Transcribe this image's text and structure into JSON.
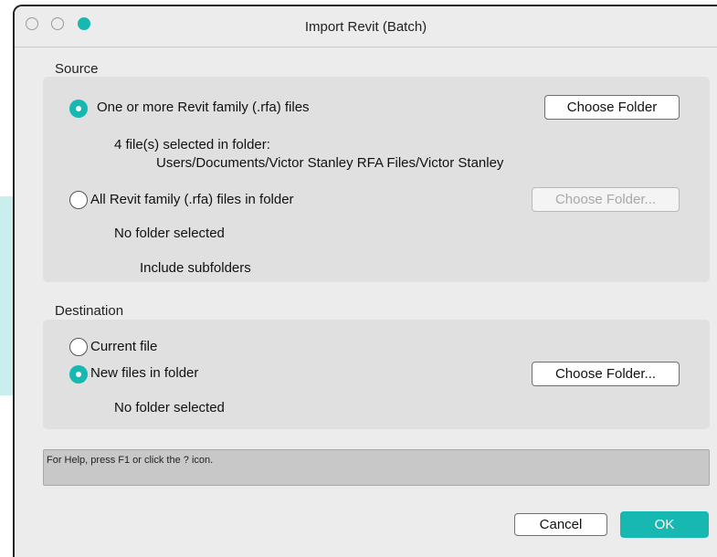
{
  "window": {
    "title": "Import Revit (Batch)"
  },
  "source": {
    "label": "Source",
    "option_files": {
      "label": "One or more Revit family (.rfa) files",
      "selected": true,
      "button_label": "Choose Folder",
      "status_line1": "4 file(s) selected in folder:",
      "status_line2": "Users/Documents/Victor Stanley RFA Files/Victor Stanley"
    },
    "option_folder": {
      "label": "All Revit family (.rfa) files in folder",
      "selected": false,
      "button_label": "Choose Folder...",
      "status": "No folder selected",
      "subfolders_label": "Include subfolders"
    }
  },
  "destination": {
    "label": "Destination",
    "option_current": {
      "label": "Current file",
      "selected": false
    },
    "option_new": {
      "label": "New files in folder",
      "selected": true,
      "button_label": "Choose Folder...",
      "status": "No folder selected"
    }
  },
  "help": {
    "text": "For Help, press F1 or click the ? icon."
  },
  "footer": {
    "cancel_label": "Cancel",
    "ok_label": "OK"
  },
  "colors": {
    "accent": "#17b7b2",
    "panel": "#e0e0e0",
    "window": "#ececec"
  }
}
